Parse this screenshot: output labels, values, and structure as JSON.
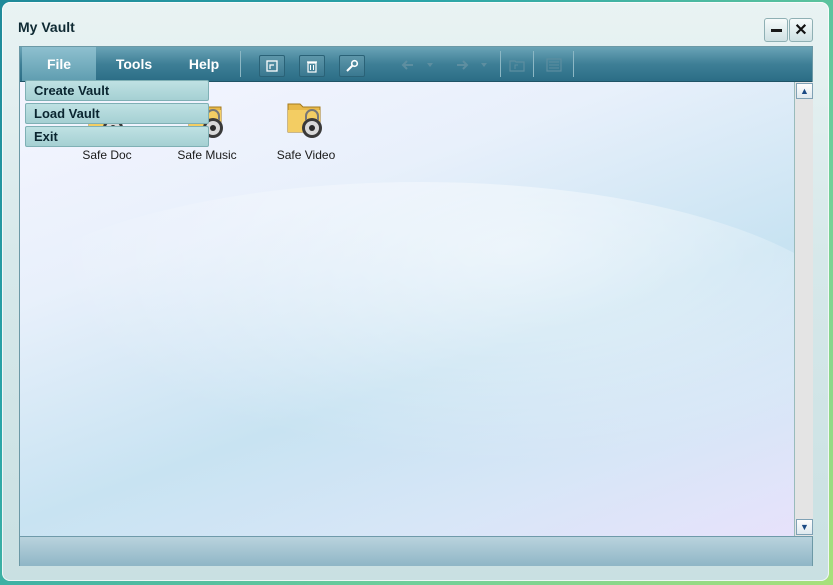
{
  "window": {
    "title": "My Vault"
  },
  "menu": {
    "file": "File",
    "tools": "Tools",
    "help": "Help"
  },
  "file_menu": [
    "Create Vault",
    "Load Vault",
    "Exit"
  ],
  "toolbar": {
    "icons": [
      "new-vault-icon",
      "trash-icon",
      "wrench-icon",
      "back-arrow-icon",
      "forward-arrow-icon",
      "folder-up-icon",
      "list-view-icon"
    ]
  },
  "items": [
    {
      "label": "Safe Doc",
      "icon": "locked-folder-icon"
    },
    {
      "label": "Safe Music",
      "icon": "locked-folder-icon"
    },
    {
      "label": "Safe Video",
      "icon": "locked-folder-icon"
    }
  ],
  "colors": {
    "menubar": "#3e7f96",
    "accent": "#6aa3b6"
  }
}
